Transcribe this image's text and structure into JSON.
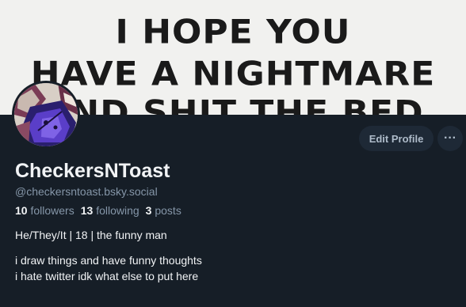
{
  "banner": {
    "lines": [
      "",
      "I HOPE YOU",
      "HAVE A NIGHTMARE",
      "AND SHIT THE BED"
    ]
  },
  "profile": {
    "display_name": "CheckersNToast",
    "handle": "@checkersntoast.bsky.social",
    "followers_count": "10",
    "followers_label": "followers",
    "following_count": "13",
    "following_label": "following",
    "posts_count": "3",
    "posts_label": "posts",
    "bio_line1": "He/They/It | 18 | the funny man",
    "bio_line2": "i draw things and have funny thoughts",
    "bio_line3": "i hate twitter idk what else to put here"
  },
  "actions": {
    "edit_label": "Edit Profile",
    "more_label": "···"
  },
  "colors": {
    "background": "#161e27",
    "button_bg": "#1e2936",
    "muted_text": "#8596a8"
  },
  "icons": {
    "more": "more-horizontal-icon"
  }
}
